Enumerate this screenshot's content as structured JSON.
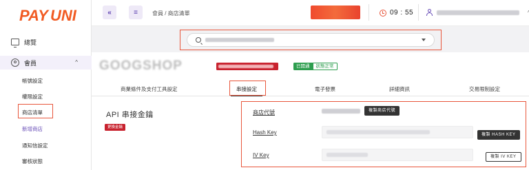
{
  "brand": {
    "logo_text": "PAY",
    "logo_text2": "UNI",
    "accent": "#f15a22",
    "purple": "#5b3fb0",
    "highlight": "#e8553a"
  },
  "sidebar": {
    "overview": "總覽",
    "member": "會員",
    "sub_items": [
      {
        "label": "帳號設定"
      },
      {
        "label": "權限設定"
      },
      {
        "label": "商店清單"
      },
      {
        "label": "新增商店"
      },
      {
        "label": "通知信設定"
      },
      {
        "label": "審核狀態"
      }
    ]
  },
  "topbar": {
    "collapse_icon": "«",
    "menu_icon": "≡",
    "breadcrumb": "會員 / 商店清單",
    "timer": "09 : 55"
  },
  "store": {
    "tag_status": "已開通",
    "tag_status2": "狀態正常"
  },
  "tabs": [
    {
      "label": "商業條件及支付工具設定"
    },
    {
      "label": "串接設定"
    },
    {
      "label": "電子發票"
    },
    {
      "label": "詳細資訊"
    },
    {
      "label": "交易限制設定"
    }
  ],
  "api": {
    "title": "API 串接金鑰",
    "change_button": "更換金鑰",
    "store_code_label": "商店代號",
    "copy_store_code": "複製商店代號",
    "hash_key_label": "Hash Key",
    "copy_hash_key": "複製 HASH KEY",
    "iv_key_label": "IV Key",
    "copy_iv_key": "複製 IV KEY"
  }
}
